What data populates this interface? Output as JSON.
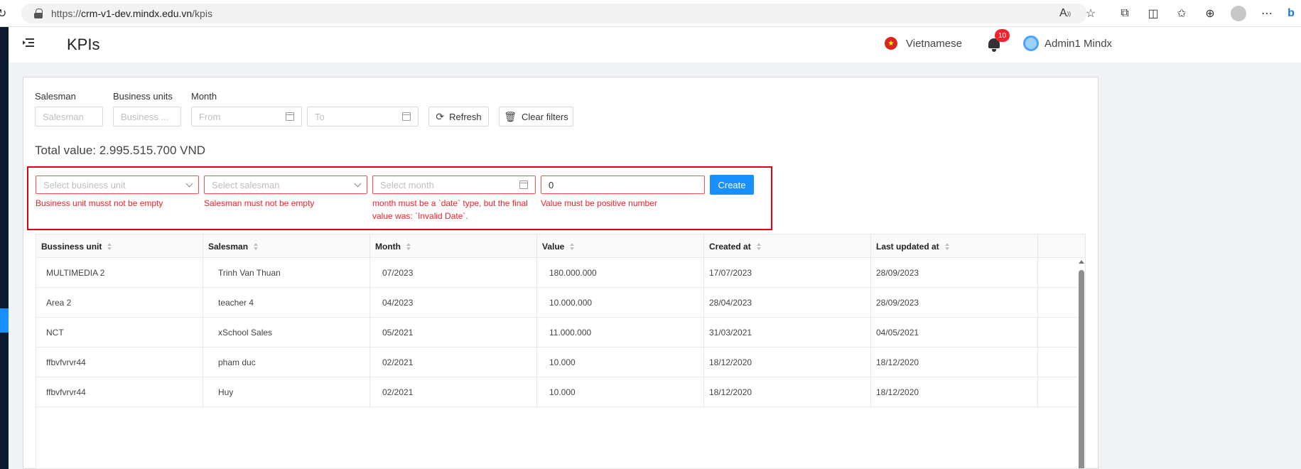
{
  "browser": {
    "url_prefix": "https://",
    "url_host": "crm-v1-dev.mindx.edu.vn",
    "url_path": "/kpis",
    "icons": [
      "read-aloud-icon",
      "favorite-icon",
      "extensions-icon",
      "split-screen-icon",
      "favorites-icon",
      "collections-icon",
      "profile-icon",
      "more-icon"
    ]
  },
  "header": {
    "title": "KPIs",
    "language": "Vietnamese",
    "notification_count": "10",
    "user_name": "Admin1 Mindx"
  },
  "filters": {
    "salesman_label": "Salesman",
    "business_units_label": "Business units",
    "month_label": "Month",
    "salesman_placeholder": "Salesman",
    "business_units_placeholder": "Business ...",
    "from_placeholder": "From",
    "to_placeholder": "To",
    "refresh_label": "Refresh",
    "clear_label": "Clear filters"
  },
  "total_value": "Total value: 2.995.515.700 VND",
  "create_form": {
    "business_unit_placeholder": "Select business unit",
    "salesman_placeholder": "Select salesman",
    "month_placeholder": "Select month",
    "value": "0",
    "create_label": "Create",
    "errors": {
      "business_unit": "Business unit musst not be empty",
      "salesman": "Salesman must not be empty",
      "month_line1": "month must be a `date` type, but the final",
      "month_line2": "value was: `Invalid Date`.",
      "value": "Value must be positive number"
    }
  },
  "table": {
    "columns": [
      "Bussiness unit",
      "Salesman",
      "Month",
      "Value",
      "Created at",
      "Last updated at"
    ],
    "rows": [
      [
        "MULTIMEDIA 2",
        "Trinh Van Thuan",
        "07/2023",
        "180.000.000",
        "17/07/2023",
        "28/09/2023"
      ],
      [
        "Area 2",
        "teacher 4",
        "04/2023",
        "10.000.000",
        "28/04/2023",
        "28/09/2023"
      ],
      [
        "NCT",
        "xSchool Sales",
        "05/2021",
        "11.000.000",
        "31/03/2021",
        "04/05/2021"
      ],
      [
        "ffbvfvrvr44",
        "pham duc",
        "02/2021",
        "10.000",
        "18/12/2020",
        "18/12/2020"
      ],
      [
        "ffbvfvrvr44",
        "Huy",
        "02/2021",
        "10.000",
        "18/12/2020",
        "18/12/2020"
      ]
    ]
  },
  "colors": {
    "primary": "#1890ff",
    "error": "#f5222d",
    "highlight": "#e0000f",
    "sidebar": "#0d1b2e"
  }
}
